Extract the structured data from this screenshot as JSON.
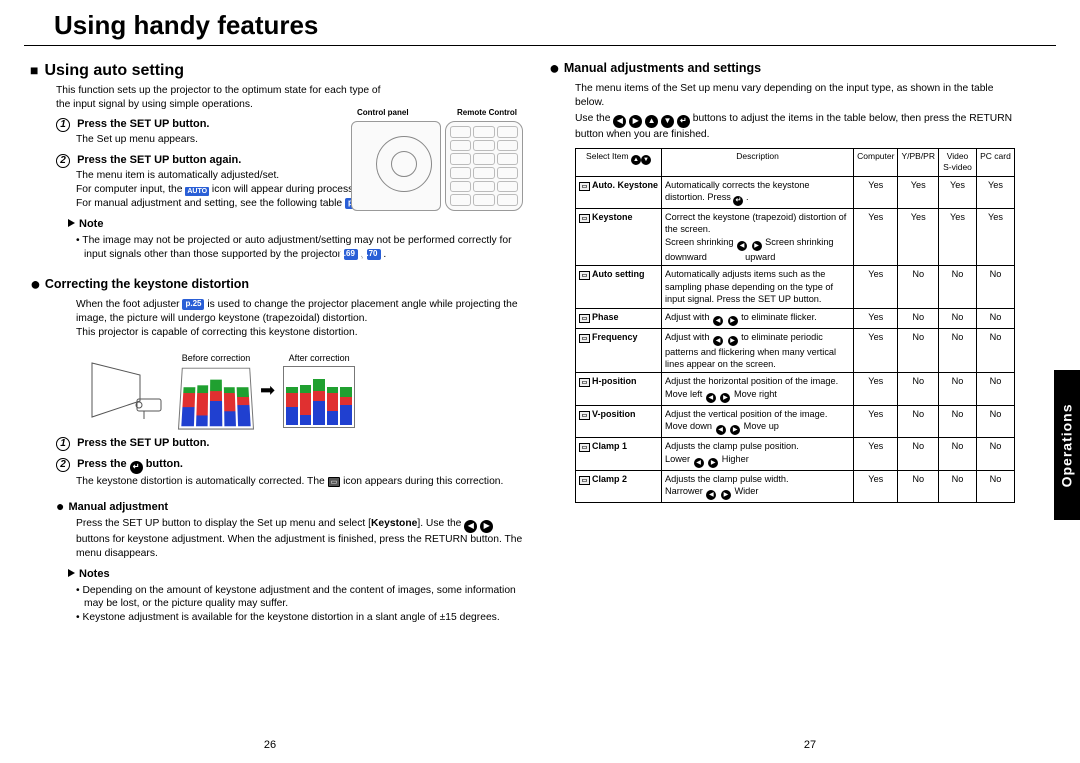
{
  "title": "Using handy features",
  "sideTab": "Operations",
  "pageLeft": "26",
  "pageRight": "27",
  "left": {
    "h2": "Using auto setting",
    "intro": "This function sets up the projector to the optimum state for each type of the input signal by using simple operations.",
    "panel": {
      "cp": "Control panel",
      "rc": "Remote Control"
    },
    "step1": "Press the SET UP button.",
    "step1b": "The Set up menu appears.",
    "step2": "Press the SET UP button again.",
    "step2b1": "The menu item is automatically adjusted/set.",
    "step2b2a": "For computer input, the ",
    "step2b2b": " icon will appear during processing.",
    "step2b3a": "For manual adjustment and setting, see the following table ",
    "p27": "p.27",
    "noteLabel": "Note",
    "note1a": "The image may not be projected or auto adjustment/setting may not be performed correctly for input signals other than those supported by the projector ",
    "p69": "p.69",
    "p70": "p.70",
    "h3a": "Correcting the keystone distortion",
    "kintroA": "When the foot adjuster ",
    "p25": "p.25",
    "kintroB": " is used to change the projector placement angle while projecting the image, the picture will undergo keystone (trapezoidal) distortion.",
    "kintroC": "This projector is capable of correcting this keystone distortion.",
    "figBefore": "Before correction",
    "figAfter": "After correction",
    "kstep1": "Press the SET UP button.",
    "kstep2a": "Press the ",
    "kstep2b": " button.",
    "kstep2bodyA": "The keystone distortion is automatically corrected. The ",
    "kstep2bodyB": " icon appears during this correction.",
    "h4manual": "Manual adjustment",
    "manualBodyA": "Press the SET UP button to display the Set up menu and select [",
    "manualBodyKW": "Keystone",
    "manualBodyB": "]. Use the ",
    "manualBodyC": " buttons for keystone adjustment. When the adjustment is finished, press the RETURN button. The menu disappears.",
    "notesLabel": "Notes",
    "notes1": "Depending on the amount of keystone adjustment and the content of images, some information may be lost, or the picture quality may suffer.",
    "notes2": "Keystone adjustment is available for the keystone distortion in a slant angle of ±15 degrees."
  },
  "right": {
    "h3": "Manual adjustments and settings",
    "intro": "The menu items of the Set up menu vary depending on the input type, as shown in the table below.",
    "useA": "Use the ",
    "useB": " buttons to adjust the items in the table below, then press the RETURN button when you are finished.",
    "th": {
      "sel": "Select Item",
      "desc": "Description",
      "c1": "Computer",
      "c2": "Y/PB/PR",
      "c3": "Video S-video",
      "c4": "PC card"
    },
    "rows": [
      {
        "label": "Auto. Keystone",
        "desc": "Automatically corrects the keystone distortion. Press ↵ .",
        "yn": [
          "Yes",
          "Yes",
          "Yes",
          "Yes"
        ]
      },
      {
        "label": "Keystone",
        "desc": "Correct the keystone (trapezoid) distortion of the screen.<br>Screen shrinking ◀ ▶ Screen shrinking<br>downward&nbsp;&nbsp;&nbsp;&nbsp;&nbsp;&nbsp;&nbsp;&nbsp;&nbsp;&nbsp;&nbsp;&nbsp;&nbsp;&nbsp;&nbsp;upward",
        "yn": [
          "Yes",
          "Yes",
          "Yes",
          "Yes"
        ]
      },
      {
        "label": "Auto setting",
        "desc": "Automatically adjusts items such as the sampling phase depending on the type of input signal. Press the SET UP button.",
        "yn": [
          "Yes",
          "No",
          "No",
          "No"
        ]
      },
      {
        "label": "Phase",
        "desc": "Adjust with ◀ ▶ to eliminate flicker.",
        "yn": [
          "Yes",
          "No",
          "No",
          "No"
        ]
      },
      {
        "label": "Frequency",
        "desc": "Adjust with ◀ ▶ to eliminate periodic patterns and flickering when many vertical lines appear on the screen.",
        "yn": [
          "Yes",
          "No",
          "No",
          "No"
        ]
      },
      {
        "label": "H-position",
        "desc": "Adjust the horizontal position of the image.<br>Move left ◀ ▶ Move right",
        "yn": [
          "Yes",
          "No",
          "No",
          "No"
        ]
      },
      {
        "label": "V-position",
        "desc": "Adjust the vertical position of the image.<br>Move down ◀ ▶ Move up",
        "yn": [
          "Yes",
          "No",
          "No",
          "No"
        ]
      },
      {
        "label": "Clamp 1",
        "desc": "Adjusts the clamp pulse position.<br>Lower ◀ ▶ Higher",
        "yn": [
          "Yes",
          "No",
          "No",
          "No"
        ]
      },
      {
        "label": "Clamp 2",
        "desc": "Adjusts the clamp pulse width.<br>Narrower ◀ ▶ Wider",
        "yn": [
          "Yes",
          "No",
          "No",
          "No"
        ]
      }
    ]
  }
}
